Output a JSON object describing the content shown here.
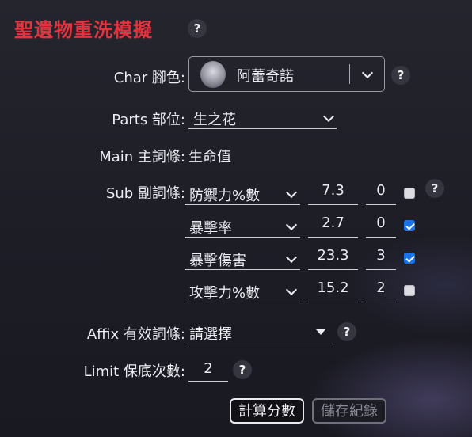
{
  "title": "聖遺物重洗模擬",
  "help_glyph": "?",
  "char": {
    "label": "Char 腳色:",
    "value": "阿蕾奇諾"
  },
  "parts": {
    "label": "Parts 部位:",
    "value": "生之花"
  },
  "main": {
    "label": "Main 主詞條:",
    "value": "生命值"
  },
  "sub": {
    "label": "Sub 副詞條:",
    "rows": [
      {
        "stat": "防禦力%數",
        "value": "7.3",
        "count": "0",
        "checked": false
      },
      {
        "stat": "暴擊率",
        "value": "2.7",
        "count": "0",
        "checked": true
      },
      {
        "stat": "暴擊傷害",
        "value": "23.3",
        "count": "3",
        "checked": true
      },
      {
        "stat": "攻擊力%數",
        "value": "15.2",
        "count": "2",
        "checked": false
      }
    ]
  },
  "affix": {
    "label": "Affix 有效詞條:",
    "placeholder": "請選擇"
  },
  "limit": {
    "label": "Limit 保底次數:",
    "value": "2"
  },
  "buttons": {
    "calculate": "計算分數",
    "save": "儲存紀錄"
  },
  "colors": {
    "title_red": "#e0343f",
    "checkbox_blue": "#1a73e8"
  }
}
